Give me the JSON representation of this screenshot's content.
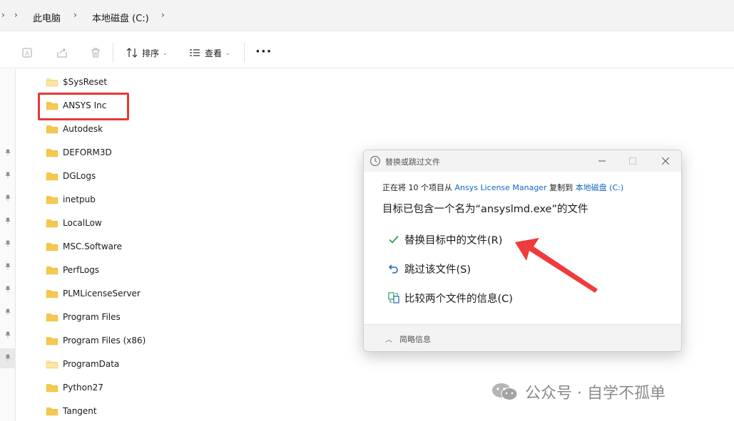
{
  "breadcrumb": {
    "sep": "›",
    "items": [
      "此电脑",
      "本地磁盘 (C:)"
    ]
  },
  "toolbar": {
    "sort_label": "排序",
    "view_label": "查看",
    "more_label": "···",
    "chevron": "⌄",
    "icons": [
      "rename-icon",
      "share-icon",
      "delete-icon"
    ]
  },
  "files": [
    "$SysReset",
    "ANSYS Inc",
    "Autodesk",
    "DEFORM3D",
    "DGLogs",
    "inetpub",
    "LocalLow",
    "MSC.Software",
    "PerfLogs",
    "PLMLicenseServer",
    "Program Files",
    "Program Files (x86)",
    "ProgramData",
    "Python27",
    "Tangent"
  ],
  "dialog": {
    "title": "替换或跳过文件",
    "line1_prefix": "正在将 10 个项目从 ",
    "source": "Ansys License Manager",
    "line1_mid": " 复制到 ",
    "destination": "本地磁盘 (C:)",
    "message": "目标已包含一个名为“ansyslmd.exe”的文件",
    "option_replace": "替换目标中的文件(R)",
    "option_skip": "跳过该文件(S)",
    "option_compare": "比较两个文件的信息(C)",
    "less_details": "简略信息",
    "chevron_up": "︿"
  },
  "watermark": {
    "text": "公众号 · 自学不孤单"
  },
  "colors": {
    "folder": "#f6c94e",
    "folder_light": "#fbe6a4",
    "highlight": "#e53935",
    "link": "#1565c0",
    "check": "#2e9e4f",
    "arrow": "#ef3b3b"
  }
}
